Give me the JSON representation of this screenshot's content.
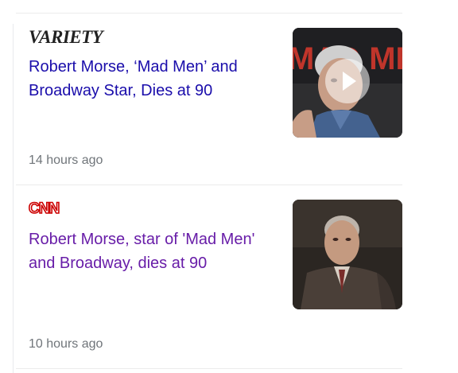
{
  "articles": [
    {
      "source": "VARIETY",
      "headline": "Robert Morse, ‘Mad Men’ and Broadway Star, Dies at 90",
      "time": "14 hours ago",
      "has_video": true,
      "poster_text": "MAD MEN"
    },
    {
      "source": "CNN",
      "headline": "Robert Morse, star of 'Mad Men' and Broadway, dies at 90",
      "time": "10 hours ago",
      "has_video": false
    }
  ],
  "colors": {
    "link_unvisited": "#1a0dab",
    "link_visited": "#681da8",
    "meta": "#70757a",
    "cnn_red": "#cc0000"
  }
}
